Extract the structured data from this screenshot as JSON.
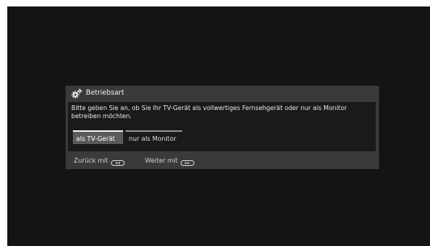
{
  "dialog": {
    "title": "Betriebsart",
    "prompt": "Bitte geben Sie an, ob Sie Ihr TV-Gerät als vollwertiges Fernsehgerät oder nur als Monitor betreiben möchten.",
    "options": [
      {
        "label": "als TV-Gerät",
        "selected": true
      },
      {
        "label": "nur als Monitor",
        "selected": false
      }
    ],
    "footer": {
      "back_label": "Zurück mit",
      "back_icon": "remote-back-key-icon",
      "next_label": "Weiter mit",
      "next_icon": "remote-ok-key-icon"
    },
    "icon": "settings-gear-icon"
  },
  "colors": {
    "screen_background": "#141414",
    "dialog_frame": "#3a3a3a",
    "dialog_body": "#1a1a1a",
    "selected_option": "#5a5a5a"
  }
}
